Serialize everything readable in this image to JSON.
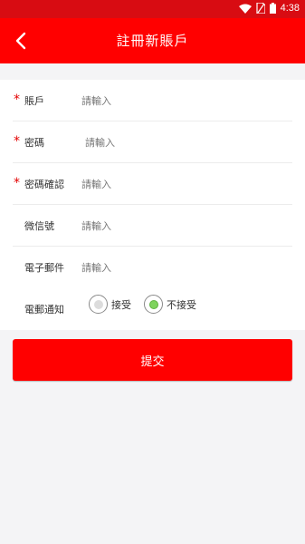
{
  "status_bar": {
    "time": "4:38"
  },
  "header": {
    "title": "註冊新賬戶"
  },
  "form": {
    "account": {
      "label": "賬戶",
      "placeholder": "請輸入",
      "required": "*"
    },
    "password": {
      "label": "密碼",
      "placeholder": "請輸入",
      "required": "*"
    },
    "confirm_password": {
      "label": "密碼確認",
      "placeholder": "請輸入",
      "required": "*"
    },
    "wechat": {
      "label": "微信號",
      "placeholder": "請輸入"
    },
    "email": {
      "label": "電子郵件",
      "placeholder": "請輸入"
    },
    "email_notification": {
      "label": "電郵通知",
      "options": [
        {
          "label": "接受",
          "selected": false
        },
        {
          "label": "不接受",
          "selected": true
        }
      ]
    }
  },
  "submit_label": "提交",
  "colors": {
    "header": "#ff0000",
    "status_bar": "#d80c12",
    "required": "#e30000",
    "radio_selected": "#7fd35e"
  },
  "icons": [
    "wifi-icon",
    "sim-icon",
    "battery-icon",
    "back-arrow-icon"
  ]
}
